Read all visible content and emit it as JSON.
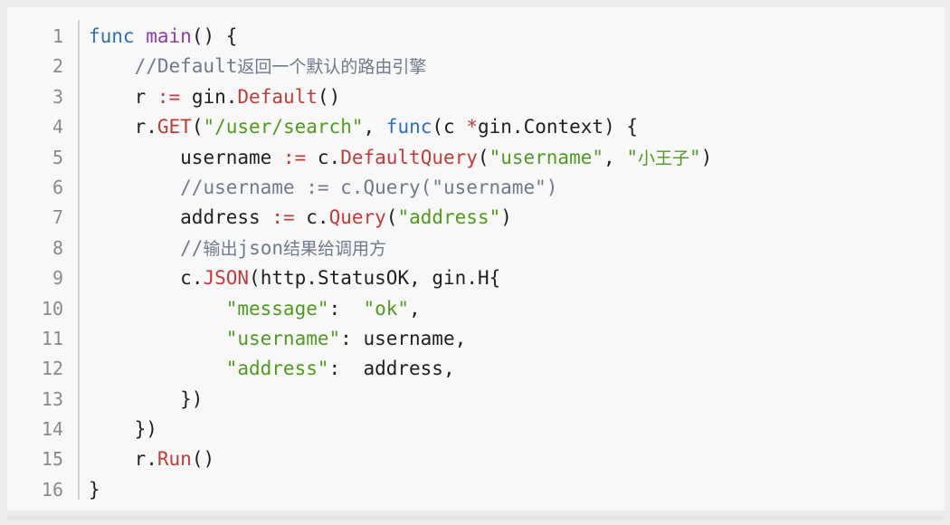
{
  "editor": {
    "line_numbers": [
      "1",
      "2",
      "3",
      "4",
      "5",
      "6",
      "7",
      "8",
      "9",
      "10",
      "11",
      "12",
      "13",
      "14",
      "15",
      "16"
    ],
    "lines": [
      {
        "indent": "",
        "tokens": [
          {
            "type": "keyword",
            "text": "func"
          },
          {
            "type": "punct",
            "text": " "
          },
          {
            "type": "func-def",
            "text": "main"
          },
          {
            "type": "punct",
            "text": "() {"
          }
        ]
      },
      {
        "indent": "    ",
        "tokens": [
          {
            "type": "comment",
            "text": "//Default"
          },
          {
            "type": "comment-cjk",
            "text": "返回一个默认的路由引擎"
          }
        ]
      },
      {
        "indent": "    ",
        "tokens": [
          {
            "type": "ident",
            "text": "r "
          },
          {
            "type": "operator",
            "text": ":="
          },
          {
            "type": "ident",
            "text": " gin"
          },
          {
            "type": "punct",
            "text": "."
          },
          {
            "type": "method",
            "text": "Default"
          },
          {
            "type": "punct",
            "text": "()"
          }
        ]
      },
      {
        "indent": "    ",
        "tokens": [
          {
            "type": "ident",
            "text": "r"
          },
          {
            "type": "punct",
            "text": "."
          },
          {
            "type": "method",
            "text": "GET"
          },
          {
            "type": "punct",
            "text": "("
          },
          {
            "type": "string",
            "text": "\"/user/search\""
          },
          {
            "type": "punct",
            "text": ", "
          },
          {
            "type": "keyword",
            "text": "func"
          },
          {
            "type": "punct",
            "text": "(c "
          },
          {
            "type": "operator",
            "text": "*"
          },
          {
            "type": "ident",
            "text": "gin"
          },
          {
            "type": "punct",
            "text": "."
          },
          {
            "type": "type",
            "text": "Context"
          },
          {
            "type": "punct",
            "text": ") {"
          }
        ]
      },
      {
        "indent": "        ",
        "tokens": [
          {
            "type": "ident",
            "text": "username "
          },
          {
            "type": "operator",
            "text": ":="
          },
          {
            "type": "ident",
            "text": " c"
          },
          {
            "type": "punct",
            "text": "."
          },
          {
            "type": "method",
            "text": "DefaultQuery"
          },
          {
            "type": "punct",
            "text": "("
          },
          {
            "type": "string",
            "text": "\"username\""
          },
          {
            "type": "punct",
            "text": ", "
          },
          {
            "type": "string",
            "text": "\""
          },
          {
            "type": "string-cjk",
            "text": "小王子"
          },
          {
            "type": "string",
            "text": "\""
          },
          {
            "type": "punct",
            "text": ")"
          }
        ]
      },
      {
        "indent": "        ",
        "tokens": [
          {
            "type": "comment",
            "text": "//username := c.Query(\"username\")"
          }
        ]
      },
      {
        "indent": "        ",
        "tokens": [
          {
            "type": "ident",
            "text": "address "
          },
          {
            "type": "operator",
            "text": ":="
          },
          {
            "type": "ident",
            "text": " c"
          },
          {
            "type": "punct",
            "text": "."
          },
          {
            "type": "method",
            "text": "Query"
          },
          {
            "type": "punct",
            "text": "("
          },
          {
            "type": "string",
            "text": "\"address\""
          },
          {
            "type": "punct",
            "text": ")"
          }
        ]
      },
      {
        "indent": "        ",
        "tokens": [
          {
            "type": "comment",
            "text": "//"
          },
          {
            "type": "comment-cjk",
            "text": "输出"
          },
          {
            "type": "comment",
            "text": "json"
          },
          {
            "type": "comment-cjk",
            "text": "结果给调用方"
          }
        ]
      },
      {
        "indent": "        ",
        "tokens": [
          {
            "type": "ident",
            "text": "c"
          },
          {
            "type": "punct",
            "text": "."
          },
          {
            "type": "method",
            "text": "JSON"
          },
          {
            "type": "punct",
            "text": "("
          },
          {
            "type": "ident",
            "text": "http"
          },
          {
            "type": "punct",
            "text": "."
          },
          {
            "type": "type",
            "text": "StatusOK"
          },
          {
            "type": "punct",
            "text": ", "
          },
          {
            "type": "ident",
            "text": "gin"
          },
          {
            "type": "punct",
            "text": "."
          },
          {
            "type": "type",
            "text": "H"
          },
          {
            "type": "punct",
            "text": "{"
          }
        ]
      },
      {
        "indent": "            ",
        "tokens": [
          {
            "type": "string",
            "text": "\"message\""
          },
          {
            "type": "punct",
            "text": ":  "
          },
          {
            "type": "string",
            "text": "\"ok\""
          },
          {
            "type": "punct",
            "text": ","
          }
        ]
      },
      {
        "indent": "            ",
        "tokens": [
          {
            "type": "string",
            "text": "\"username\""
          },
          {
            "type": "punct",
            "text": ": "
          },
          {
            "type": "ident",
            "text": "username"
          },
          {
            "type": "punct",
            "text": ","
          }
        ]
      },
      {
        "indent": "            ",
        "tokens": [
          {
            "type": "string",
            "text": "\"address\""
          },
          {
            "type": "punct",
            "text": ":  "
          },
          {
            "type": "ident",
            "text": "address"
          },
          {
            "type": "punct",
            "text": ","
          }
        ]
      },
      {
        "indent": "        ",
        "tokens": [
          {
            "type": "punct",
            "text": "})"
          }
        ]
      },
      {
        "indent": "    ",
        "tokens": [
          {
            "type": "punct",
            "text": "})"
          }
        ]
      },
      {
        "indent": "    ",
        "tokens": [
          {
            "type": "ident",
            "text": "r"
          },
          {
            "type": "punct",
            "text": "."
          },
          {
            "type": "method",
            "text": "Run"
          },
          {
            "type": "punct",
            "text": "()"
          }
        ]
      },
      {
        "indent": "",
        "tokens": [
          {
            "type": "punct",
            "text": "}"
          }
        ]
      }
    ]
  },
  "colors": {
    "keyword": "#2f6fb5",
    "func_def": "#8c3fa8",
    "comment": "#6f7a8a",
    "string": "#4f9a1f",
    "method": "#c23b3b",
    "operator": "#c23b3b",
    "text": "#1f1f1f",
    "line_number": "#8a8a8a",
    "background": "#f8f8f8"
  }
}
